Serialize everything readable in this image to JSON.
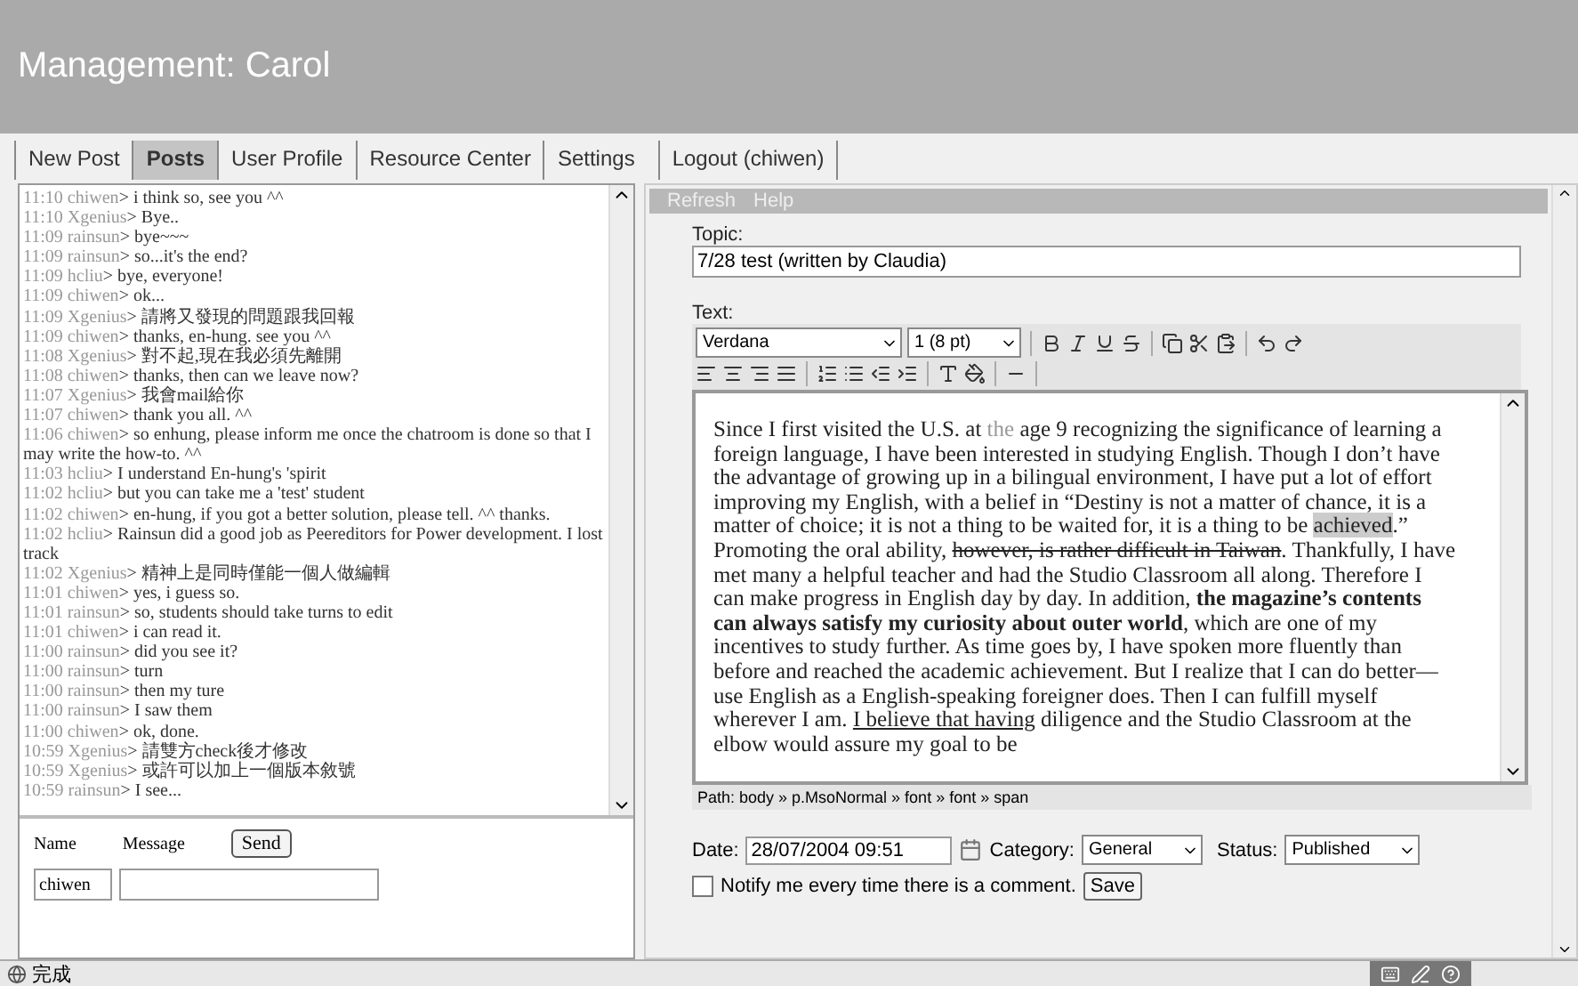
{
  "header": {
    "title": "Management: Carol"
  },
  "tabs": [
    {
      "label": "New Post",
      "selected": false
    },
    {
      "label": "Posts",
      "selected": true
    },
    {
      "label": "User Profile",
      "selected": false
    },
    {
      "label": "Resource Center",
      "selected": false
    },
    {
      "label": "Settings",
      "selected": false
    },
    {
      "label": "Logout (chiwen)",
      "selected": false
    }
  ],
  "chat": {
    "messages": [
      {
        "time": "11:10",
        "user": "chiwen",
        "text": "> i think so, see you ^^"
      },
      {
        "time": "11:10",
        "user": "Xgenius",
        "text": "> Bye.."
      },
      {
        "time": "11:09",
        "user": "rainsun",
        "text": "> bye~~~"
      },
      {
        "time": "11:09",
        "user": "rainsun",
        "text": "> so...it's the end?"
      },
      {
        "time": "11:09",
        "user": "hcliu",
        "text": "> bye, everyone!"
      },
      {
        "time": "11:09",
        "user": "chiwen",
        "text": "> ok..."
      },
      {
        "time": "11:09",
        "user": "Xgenius",
        "text": "> 請將又發現的問題跟我回報"
      },
      {
        "time": "11:09",
        "user": "chiwen",
        "text": "> thanks, en-hung. see you ^^"
      },
      {
        "time": "11:08",
        "user": "Xgenius",
        "text": "> 對不起,現在我必須先離開"
      },
      {
        "time": "11:08",
        "user": "chiwen",
        "text": "> thanks, then can we leave now?"
      },
      {
        "time": "11:07",
        "user": "Xgenius",
        "text": "> 我會mail給你"
      },
      {
        "time": "11:07",
        "user": "chiwen",
        "text": "> thank you all. ^^"
      },
      {
        "time": "11:06",
        "user": "chiwen",
        "text": "> so enhung, please inform me once the chatroom is done so that I may write the how-to. ^^"
      },
      {
        "time": "11:03",
        "user": "hcliu",
        "text": "> I understand En-hung's 'spirit"
      },
      {
        "time": "11:02",
        "user": "hcliu",
        "text": "> but you can take me a 'test' student"
      },
      {
        "time": "11:02",
        "user": "chiwen",
        "text": "> en-hung, if you got a better solution, please tell. ^^ thanks."
      },
      {
        "time": "11:02",
        "user": "hcliu",
        "text": "> Rainsun did a good job as Peereditors for Power development. I lost track"
      },
      {
        "time": "11:02",
        "user": "Xgenius",
        "text": "> 精神上是同時僅能一個人做編輯"
      },
      {
        "time": "11:01",
        "user": "chiwen",
        "text": "> yes, i guess so."
      },
      {
        "time": "11:01",
        "user": "rainsun",
        "text": "> so, students should take turns to edit"
      },
      {
        "time": "11:01",
        "user": "chiwen",
        "text": "> i can read it."
      },
      {
        "time": "11:00",
        "user": "rainsun",
        "text": "> did you see it?"
      },
      {
        "time": "11:00",
        "user": "rainsun",
        "text": "> turn"
      },
      {
        "time": "11:00",
        "user": "rainsun",
        "text": "> then my ture"
      },
      {
        "time": "11:00",
        "user": "rainsun",
        "text": "> I saw them"
      },
      {
        "time": "11:00",
        "user": "chiwen",
        "text": "> ok, done."
      },
      {
        "time": "10:59",
        "user": "Xgenius",
        "text": "> 請雙方check後才修改"
      },
      {
        "time": "10:59",
        "user": "Xgenius",
        "text": "> 或許可以加上一個版本敘號"
      },
      {
        "time": "10:59",
        "user": "rainsun",
        "text": "> I see..."
      }
    ],
    "name_label": "Name",
    "message_label": "Message",
    "send_button": "Send",
    "name_value": "chiwen"
  },
  "editor": {
    "menu": [
      "Refresh",
      "Help"
    ],
    "topic_label": "Topic:",
    "topic_value": "7/28 test (written by Claudia)",
    "text_label": "Text:",
    "font_select": "Verdana",
    "size_select": "1 (8 pt)",
    "body": [
      {
        "kind": "plain",
        "text": "Since I first visited the U.S. at "
      },
      {
        "kind": "muted",
        "text": "the"
      },
      {
        "kind": "plain",
        "text": " age 9 recognizing the significance of learning a foreign language, I have been interested in studying English. Though I don’t have the advantage of growing up in a bilingual environment, I have put a lot of effort improving my English, with a belief in “Destiny is not a matter of chance, it is a matter of choice; it is not a thing to be waited for, it is a thing to be "
      },
      {
        "kind": "highlight",
        "text": "achieved"
      },
      {
        "kind": "plain",
        "text": ".” Promoting the oral ability, "
      },
      {
        "kind": "strike",
        "text": "however, is rather difficult in Taiwan"
      },
      {
        "kind": "plain",
        "text": ". Thankfully, I have met many a helpful teacher and had the Studio Classroom all along. Therefore I can make progress in English day by day. In addition, "
      },
      {
        "kind": "bold",
        "text": "the magazine’s contents  can always satisfy my curiosity about outer world"
      },
      {
        "kind": "plain",
        "text": ", which are one of my incentives to study further. As time goes by, I have spoken more fluently than before and reached the academic achievement. But I realize that I can do better—use English as a English-speaking foreigner does. Then I can fulfill myself wherever I am. "
      },
      {
        "kind": "underline",
        "text": "I believe that having"
      },
      {
        "kind": "plain",
        "text": " diligence and the Studio Classroom at the elbow would assure my goal to be"
      }
    ],
    "path": "Path:  body » p.MsoNormal » font » font » span",
    "date_label": "Date:",
    "date_value": "28/07/2004 09:51",
    "category_label": "Category:",
    "category_value": "General",
    "status_label": "Status:",
    "status_value": "Published",
    "notify": {
      "label": "Notify me every time there is a comment.",
      "checked": false
    },
    "save_button": "Save"
  },
  "status_bar": {
    "text": "完成"
  }
}
